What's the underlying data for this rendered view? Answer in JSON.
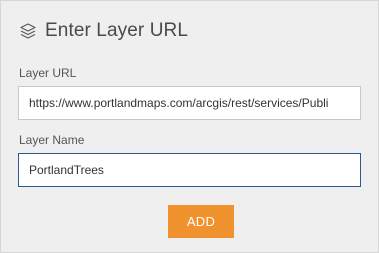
{
  "panel": {
    "title": "Enter Layer URL",
    "title_icon": "layers-icon"
  },
  "layer_url": {
    "label": "Layer URL",
    "value": "https://www.portlandmaps.com/arcgis/rest/services/Publi"
  },
  "layer_name": {
    "label": "Layer Name",
    "value": "PortlandTrees"
  },
  "actions": {
    "add_label": "ADD"
  },
  "colors": {
    "accent": "#f0922e",
    "focus_border": "#2b5a93",
    "panel_bg": "#efefef"
  }
}
